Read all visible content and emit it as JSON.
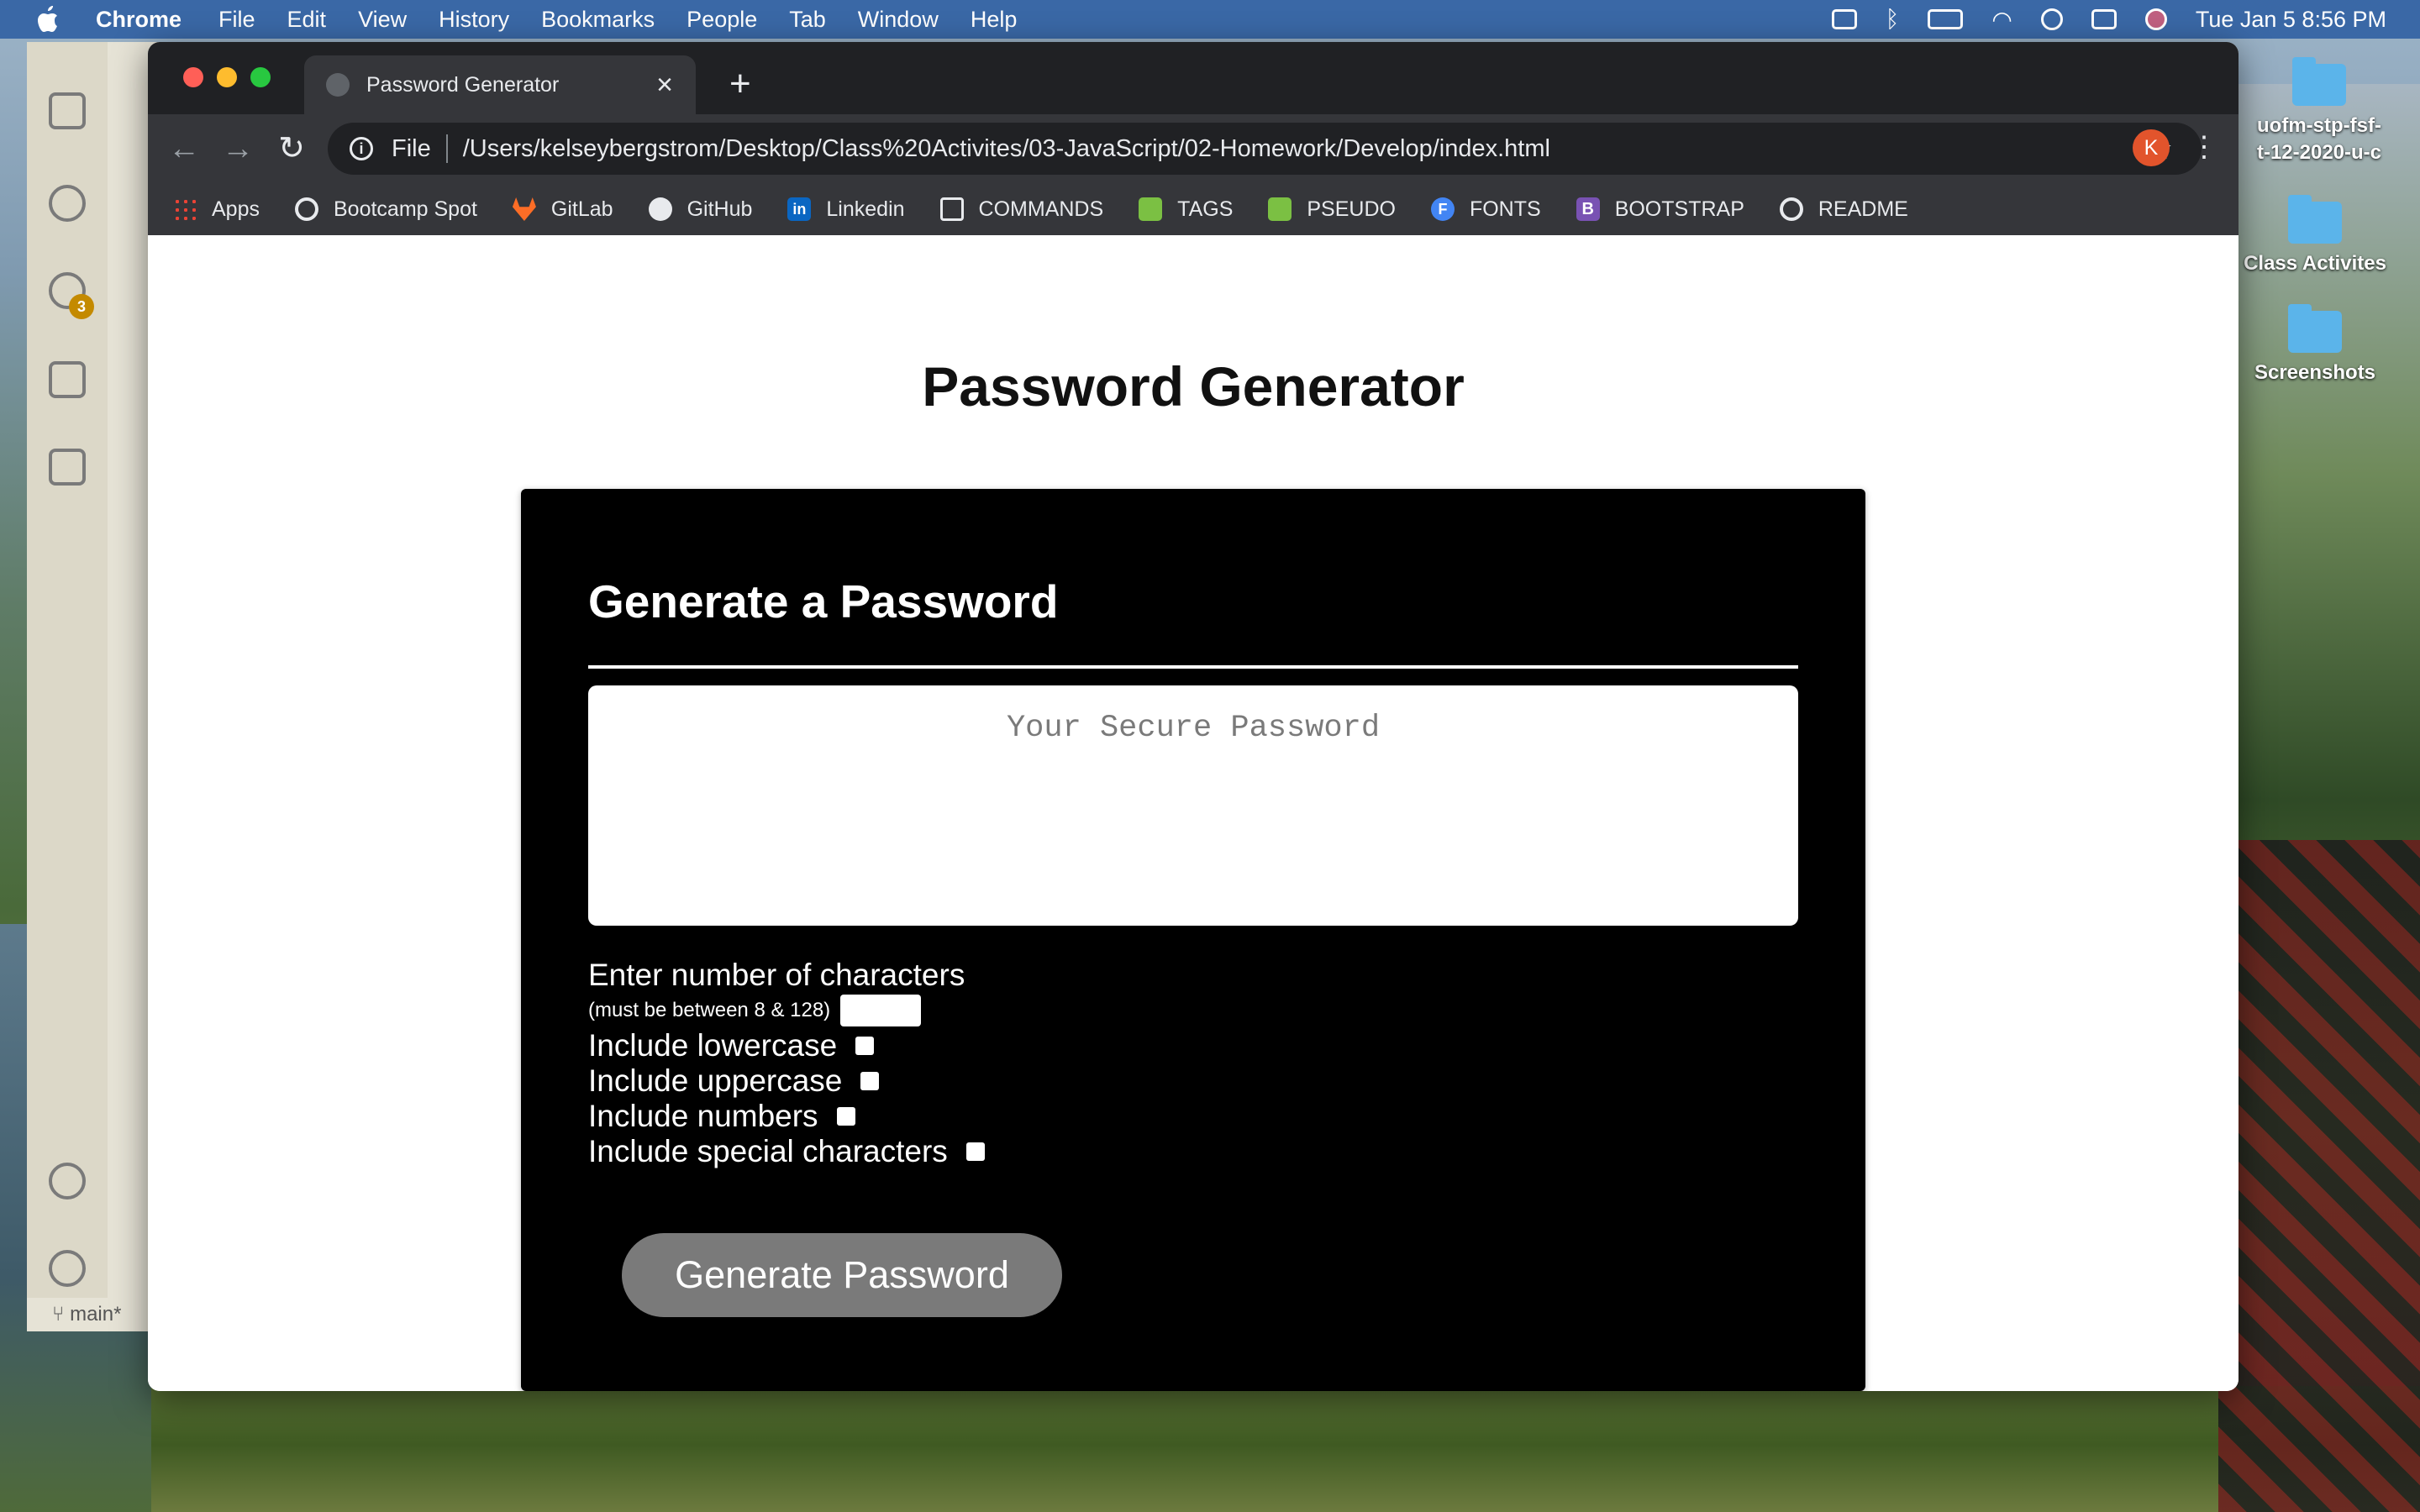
{
  "menubar": {
    "app": "Chrome",
    "menus": [
      "File",
      "Edit",
      "View",
      "History",
      "Bookmarks",
      "People",
      "Tab",
      "Window",
      "Help"
    ],
    "datetime": "Tue Jan 5  8:56 PM"
  },
  "desktop": {
    "icons": [
      "uofm-stp-fsf-\nt-12-2020-u-c",
      "Class Activites",
      "Screenshots"
    ]
  },
  "vscode": {
    "scm_badge": "3",
    "branch": "main*"
  },
  "browser": {
    "tab_title": "Password Generator",
    "url_scheme": "File",
    "url": "/Users/kelseybergstrom/Desktop/Class%20Activites/03-JavaScript/02-Homework/Develop/index.html",
    "profile_initial": "K",
    "bookmarks": [
      {
        "label": "Apps",
        "icon": "apps-grid-icon"
      },
      {
        "label": "Bootcamp Spot",
        "icon": "globe-icon"
      },
      {
        "label": "GitLab",
        "icon": "gitlab-icon"
      },
      {
        "label": "GitHub",
        "icon": "github-icon"
      },
      {
        "label": "Linkedin",
        "icon": "linkedin-icon"
      },
      {
        "label": "COMMANDS",
        "icon": "terminal-icon"
      },
      {
        "label": "TAGS",
        "icon": "tags-icon"
      },
      {
        "label": "PSEUDO",
        "icon": "pseudo-icon"
      },
      {
        "label": "FONTS",
        "icon": "fonts-icon"
      },
      {
        "label": "BOOTSTRAP",
        "icon": "bootstrap-icon"
      },
      {
        "label": "README",
        "icon": "globe-icon"
      }
    ]
  },
  "page": {
    "title": "Password Generator",
    "card_heading": "Generate a Password",
    "password_placeholder": "Your Secure Password",
    "length_label": "Enter number of characters",
    "length_hint": "(must be between 8 & 128)",
    "options": [
      {
        "label": "Include lowercase",
        "checked": false
      },
      {
        "label": "Include uppercase",
        "checked": false
      },
      {
        "label": "Include numbers",
        "checked": false
      },
      {
        "label": "Include special characters",
        "checked": false
      }
    ],
    "button": "Generate Password"
  }
}
